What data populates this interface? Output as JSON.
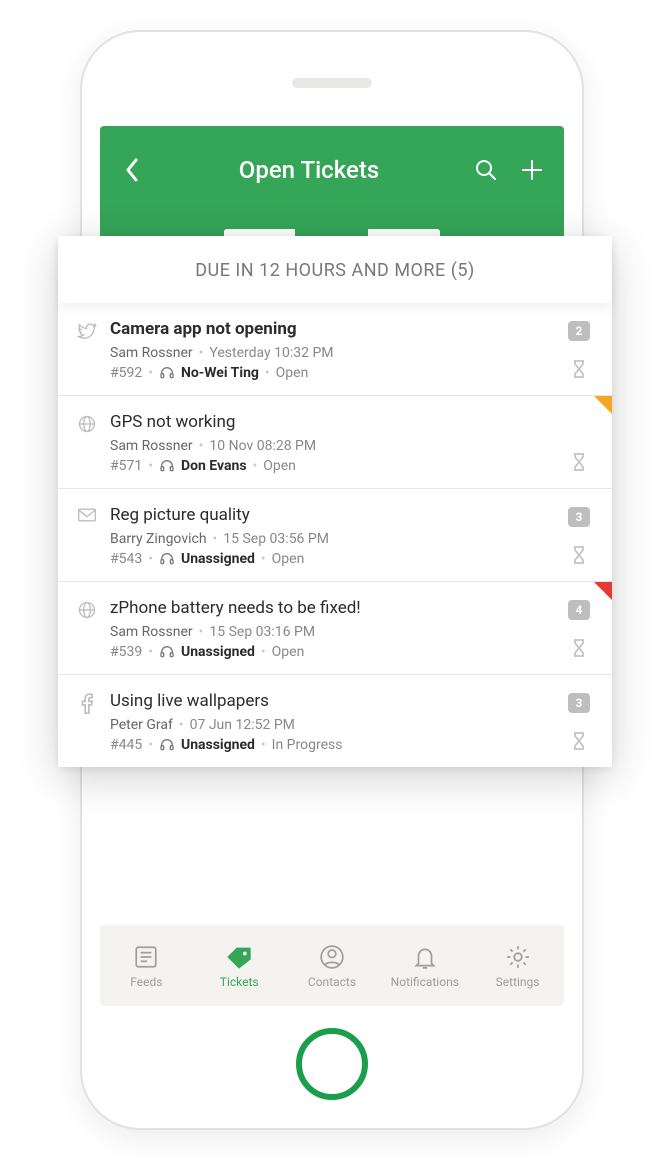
{
  "header": {
    "title": "Open Tickets"
  },
  "section": {
    "label": "DUE IN 12 HOURS AND MORE (5)"
  },
  "tickets": [
    {
      "source": "twitter",
      "title": "Camera app not opening",
      "bold": true,
      "requester": "Sam Rossner",
      "timestamp": "Yesterday 10:32 PM",
      "id": "#592",
      "agent": "No-Wei Ting",
      "status": "Open",
      "badge": "2",
      "flag": null
    },
    {
      "source": "web",
      "title": "GPS not working",
      "bold": false,
      "requester": "Sam Rossner",
      "timestamp": "10 Nov 08:28 PM",
      "id": "#571",
      "agent": "Don Evans",
      "status": "Open",
      "badge": null,
      "flag": "orange"
    },
    {
      "source": "email",
      "title": "Reg picture quality",
      "bold": false,
      "requester": "Barry Zingovich",
      "timestamp": "15 Sep 03:56 PM",
      "id": "#543",
      "agent": "Unassigned",
      "status": "Open",
      "badge": "3",
      "flag": null
    },
    {
      "source": "web",
      "title": "zPhone battery needs to be fixed!",
      "bold": false,
      "requester": "Sam Rossner",
      "timestamp": "15 Sep 03:16 PM",
      "id": "#539",
      "agent": "Unassigned",
      "status": "Open",
      "badge": "4",
      "flag": "red"
    },
    {
      "source": "facebook",
      "title": "Using live wallpapers",
      "bold": false,
      "requester": "Peter Graf",
      "timestamp": "07 Jun 12:52 PM",
      "id": "#445",
      "agent": "Unassigned",
      "status": "In Progress",
      "badge": "3",
      "flag": null
    }
  ],
  "tabs": {
    "feeds": "Feeds",
    "tickets": "Tickets",
    "contacts": "Contacts",
    "notifications": "Notifications",
    "settings": "Settings"
  }
}
